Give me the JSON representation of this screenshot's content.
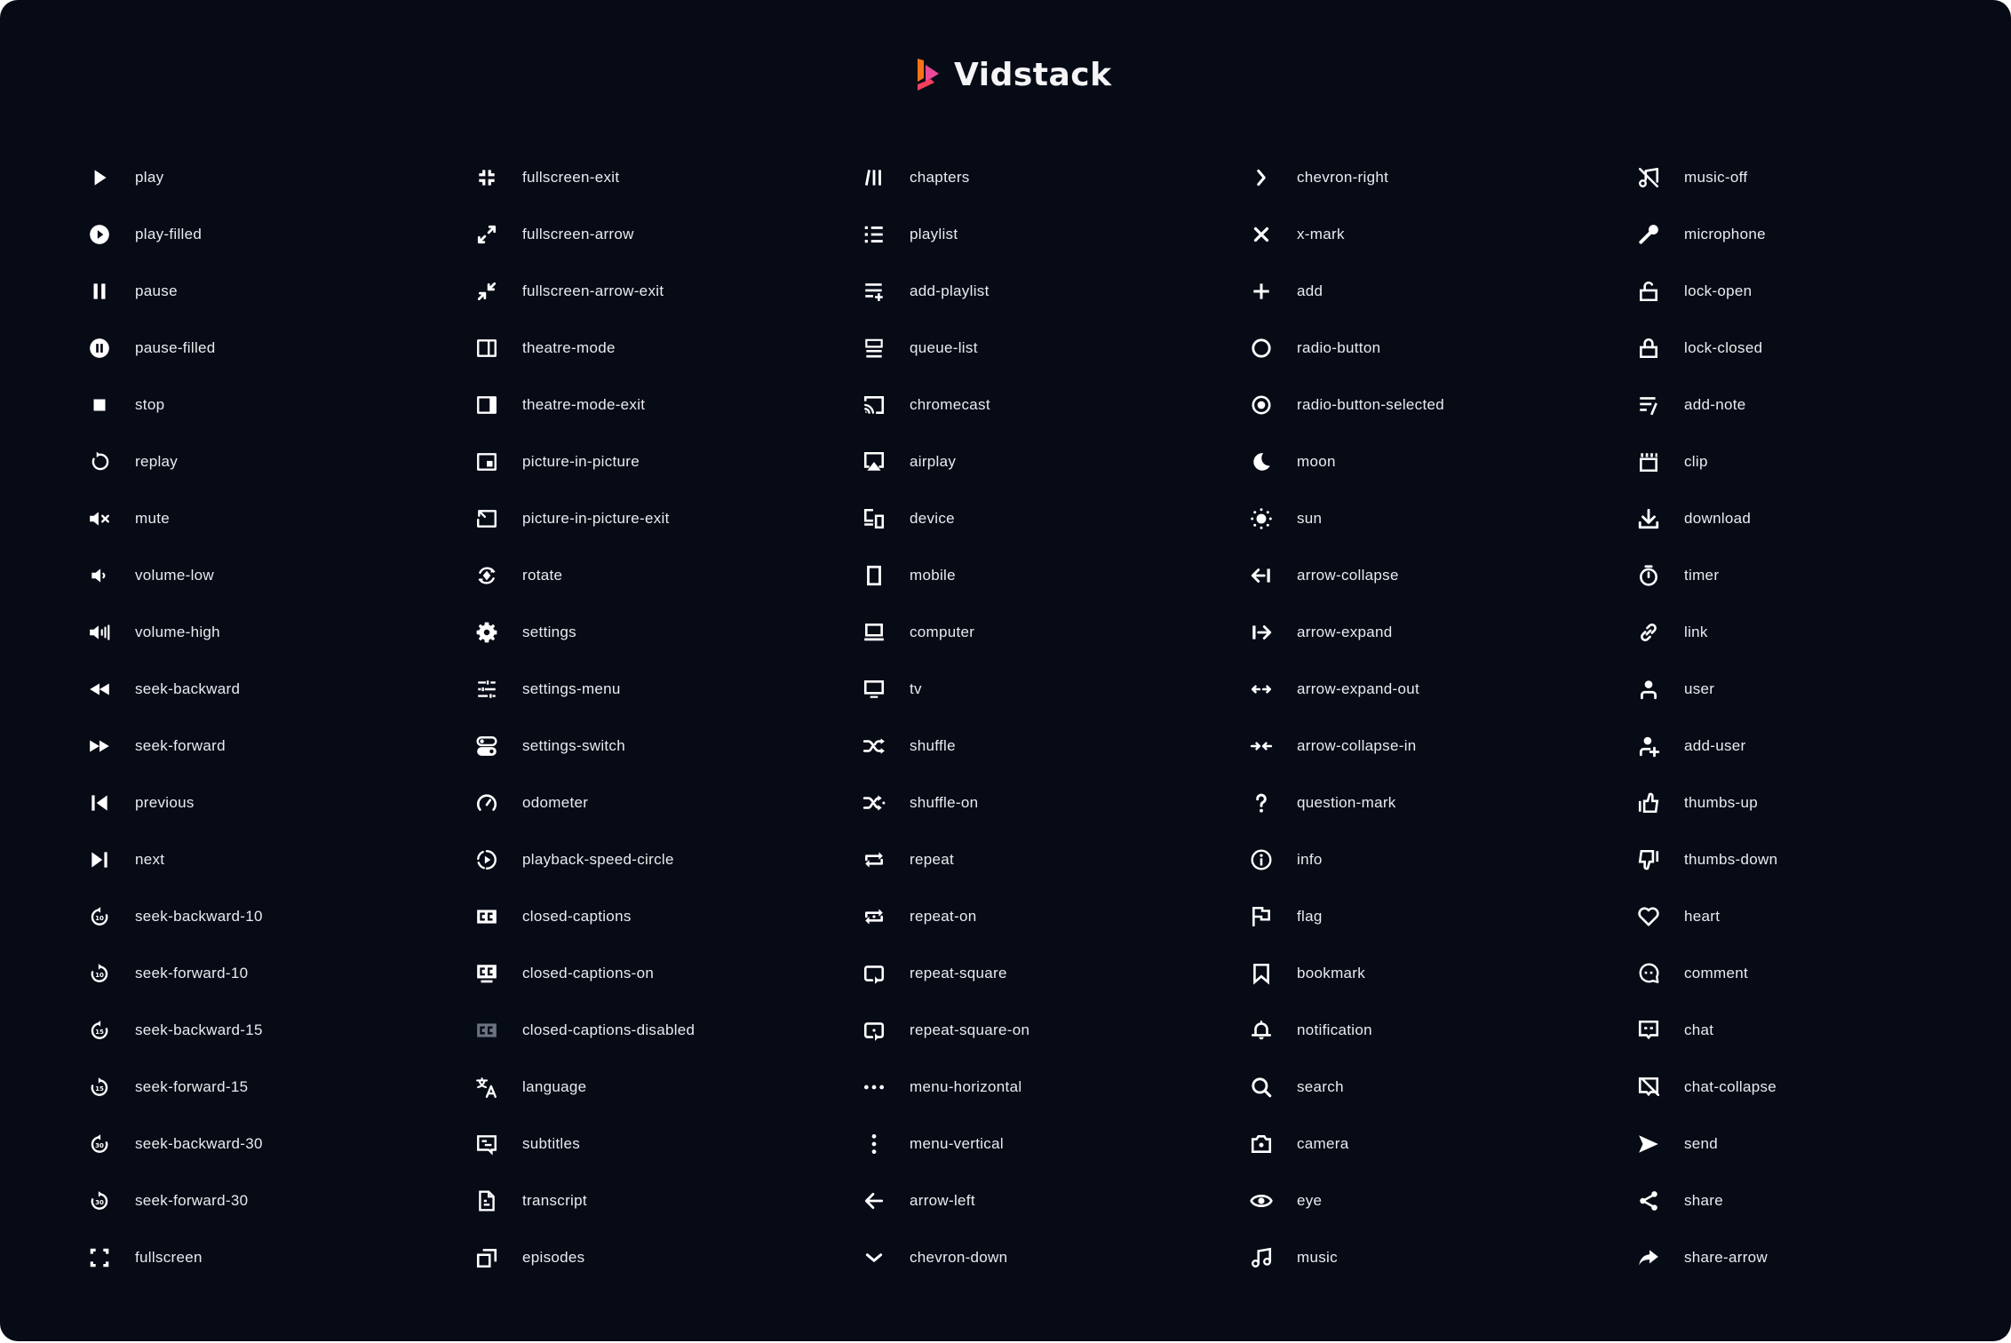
{
  "brand": {
    "name": "Vidstack",
    "colors": {
      "bar": "#f97316",
      "triangle": "#ec4899",
      "wedge": "#f43f5e"
    }
  },
  "theme": {
    "background": "#060b16",
    "text": "#e9ebef",
    "icon": "#ffffff",
    "disabled_icon": "#6b7280"
  },
  "columns": [
    {
      "items": [
        {
          "label": "play",
          "icon": "play-icon"
        },
        {
          "label": "play-filled",
          "icon": "play-filled-icon"
        },
        {
          "label": "pause",
          "icon": "pause-icon"
        },
        {
          "label": "pause-filled",
          "icon": "pause-filled-icon"
        },
        {
          "label": "stop",
          "icon": "stop-icon"
        },
        {
          "label": "replay",
          "icon": "replay-icon"
        },
        {
          "label": "mute",
          "icon": "mute-icon"
        },
        {
          "label": "volume-low",
          "icon": "volume-low-icon"
        },
        {
          "label": "volume-high",
          "icon": "volume-high-icon"
        },
        {
          "label": "seek-backward",
          "icon": "seek-backward-icon"
        },
        {
          "label": "seek-forward",
          "icon": "seek-forward-icon"
        },
        {
          "label": "previous",
          "icon": "previous-icon"
        },
        {
          "label": "next",
          "icon": "next-icon"
        },
        {
          "label": "seek-backward-10",
          "icon": "seek-backward-10-icon",
          "badge": "10"
        },
        {
          "label": "seek-forward-10",
          "icon": "seek-forward-10-icon",
          "badge": "10"
        },
        {
          "label": "seek-backward-15",
          "icon": "seek-backward-15-icon",
          "badge": "15"
        },
        {
          "label": "seek-forward-15",
          "icon": "seek-forward-15-icon",
          "badge": "15"
        },
        {
          "label": "seek-backward-30",
          "icon": "seek-backward-30-icon",
          "badge": "30"
        },
        {
          "label": "seek-forward-30",
          "icon": "seek-forward-30-icon",
          "badge": "30"
        },
        {
          "label": "fullscreen",
          "icon": "fullscreen-icon"
        }
      ]
    },
    {
      "items": [
        {
          "label": "fullscreen-exit",
          "icon": "fullscreen-exit-icon"
        },
        {
          "label": "fullscreen-arrow",
          "icon": "fullscreen-arrow-icon"
        },
        {
          "label": "fullscreen-arrow-exit",
          "icon": "fullscreen-arrow-exit-icon"
        },
        {
          "label": "theatre-mode",
          "icon": "theatre-mode-icon"
        },
        {
          "label": "theatre-mode-exit",
          "icon": "theatre-mode-exit-icon"
        },
        {
          "label": "picture-in-picture",
          "icon": "picture-in-picture-icon"
        },
        {
          "label": "picture-in-picture-exit",
          "icon": "picture-in-picture-exit-icon"
        },
        {
          "label": "rotate",
          "icon": "rotate-icon"
        },
        {
          "label": "settings",
          "icon": "settings-icon"
        },
        {
          "label": "settings-menu",
          "icon": "settings-menu-icon"
        },
        {
          "label": "settings-switch",
          "icon": "settings-switch-icon"
        },
        {
          "label": "odometer",
          "icon": "odometer-icon"
        },
        {
          "label": "playback-speed-circle",
          "icon": "playback-speed-circle-icon"
        },
        {
          "label": "closed-captions",
          "icon": "closed-captions-icon"
        },
        {
          "label": "closed-captions-on",
          "icon": "closed-captions-on-icon"
        },
        {
          "label": "closed-captions-disabled",
          "icon": "closed-captions-disabled-icon"
        },
        {
          "label": "language",
          "icon": "language-icon"
        },
        {
          "label": "subtitles",
          "icon": "subtitles-icon"
        },
        {
          "label": "transcript",
          "icon": "transcript-icon"
        },
        {
          "label": "episodes",
          "icon": "episodes-icon"
        }
      ]
    },
    {
      "items": [
        {
          "label": "chapters",
          "icon": "chapters-icon"
        },
        {
          "label": "playlist",
          "icon": "playlist-icon"
        },
        {
          "label": "add-playlist",
          "icon": "add-playlist-icon"
        },
        {
          "label": "queue-list",
          "icon": "queue-list-icon"
        },
        {
          "label": "chromecast",
          "icon": "chromecast-icon"
        },
        {
          "label": "airplay",
          "icon": "airplay-icon"
        },
        {
          "label": "device",
          "icon": "device-icon"
        },
        {
          "label": "mobile",
          "icon": "mobile-icon"
        },
        {
          "label": "computer",
          "icon": "computer-icon"
        },
        {
          "label": "tv",
          "icon": "tv-icon"
        },
        {
          "label": "shuffle",
          "icon": "shuffle-icon"
        },
        {
          "label": "shuffle-on",
          "icon": "shuffle-on-icon"
        },
        {
          "label": "repeat",
          "icon": "repeat-icon"
        },
        {
          "label": "repeat-on",
          "icon": "repeat-on-icon"
        },
        {
          "label": "repeat-square",
          "icon": "repeat-square-icon"
        },
        {
          "label": "repeat-square-on",
          "icon": "repeat-square-on-icon"
        },
        {
          "label": "menu-horizontal",
          "icon": "menu-horizontal-icon"
        },
        {
          "label": "menu-vertical",
          "icon": "menu-vertical-icon"
        },
        {
          "label": "arrow-left",
          "icon": "arrow-left-icon"
        },
        {
          "label": "chevron-down",
          "icon": "chevron-down-icon"
        }
      ]
    },
    {
      "items": [
        {
          "label": "chevron-right",
          "icon": "chevron-right-icon"
        },
        {
          "label": "x-mark",
          "icon": "x-mark-icon"
        },
        {
          "label": "add",
          "icon": "add-icon"
        },
        {
          "label": "radio-button",
          "icon": "radio-button-icon"
        },
        {
          "label": "radio-button-selected",
          "icon": "radio-button-selected-icon"
        },
        {
          "label": "moon",
          "icon": "moon-icon"
        },
        {
          "label": "sun",
          "icon": "sun-icon"
        },
        {
          "label": "arrow-collapse",
          "icon": "arrow-collapse-icon"
        },
        {
          "label": "arrow-expand",
          "icon": "arrow-expand-icon"
        },
        {
          "label": "arrow-expand-out",
          "icon": "arrow-expand-out-icon"
        },
        {
          "label": "arrow-collapse-in",
          "icon": "arrow-collapse-in-icon"
        },
        {
          "label": "question-mark",
          "icon": "question-mark-icon"
        },
        {
          "label": "info",
          "icon": "info-icon"
        },
        {
          "label": "flag",
          "icon": "flag-icon"
        },
        {
          "label": "bookmark",
          "icon": "bookmark-icon"
        },
        {
          "label": "notification",
          "icon": "notification-icon"
        },
        {
          "label": "search",
          "icon": "search-icon"
        },
        {
          "label": "camera",
          "icon": "camera-icon"
        },
        {
          "label": "eye",
          "icon": "eye-icon"
        },
        {
          "label": "music",
          "icon": "music-icon"
        }
      ]
    },
    {
      "items": [
        {
          "label": "music-off",
          "icon": "music-off-icon"
        },
        {
          "label": "microphone",
          "icon": "microphone-icon"
        },
        {
          "label": "lock-open",
          "icon": "lock-open-icon"
        },
        {
          "label": "lock-closed",
          "icon": "lock-closed-icon"
        },
        {
          "label": "add-note",
          "icon": "add-note-icon"
        },
        {
          "label": "clip",
          "icon": "clip-icon"
        },
        {
          "label": "download",
          "icon": "download-icon"
        },
        {
          "label": "timer",
          "icon": "timer-icon"
        },
        {
          "label": "link",
          "icon": "link-icon"
        },
        {
          "label": "user",
          "icon": "user-icon"
        },
        {
          "label": "add-user",
          "icon": "add-user-icon"
        },
        {
          "label": "thumbs-up",
          "icon": "thumbs-up-icon"
        },
        {
          "label": "thumbs-down",
          "icon": "thumbs-down-icon"
        },
        {
          "label": "heart",
          "icon": "heart-icon"
        },
        {
          "label": "comment",
          "icon": "comment-icon"
        },
        {
          "label": "chat",
          "icon": "chat-icon"
        },
        {
          "label": "chat-collapse",
          "icon": "chat-collapse-icon"
        },
        {
          "label": "send",
          "icon": "send-icon"
        },
        {
          "label": "share",
          "icon": "share-icon"
        },
        {
          "label": "share-arrow",
          "icon": "share-arrow-icon"
        }
      ]
    }
  ]
}
